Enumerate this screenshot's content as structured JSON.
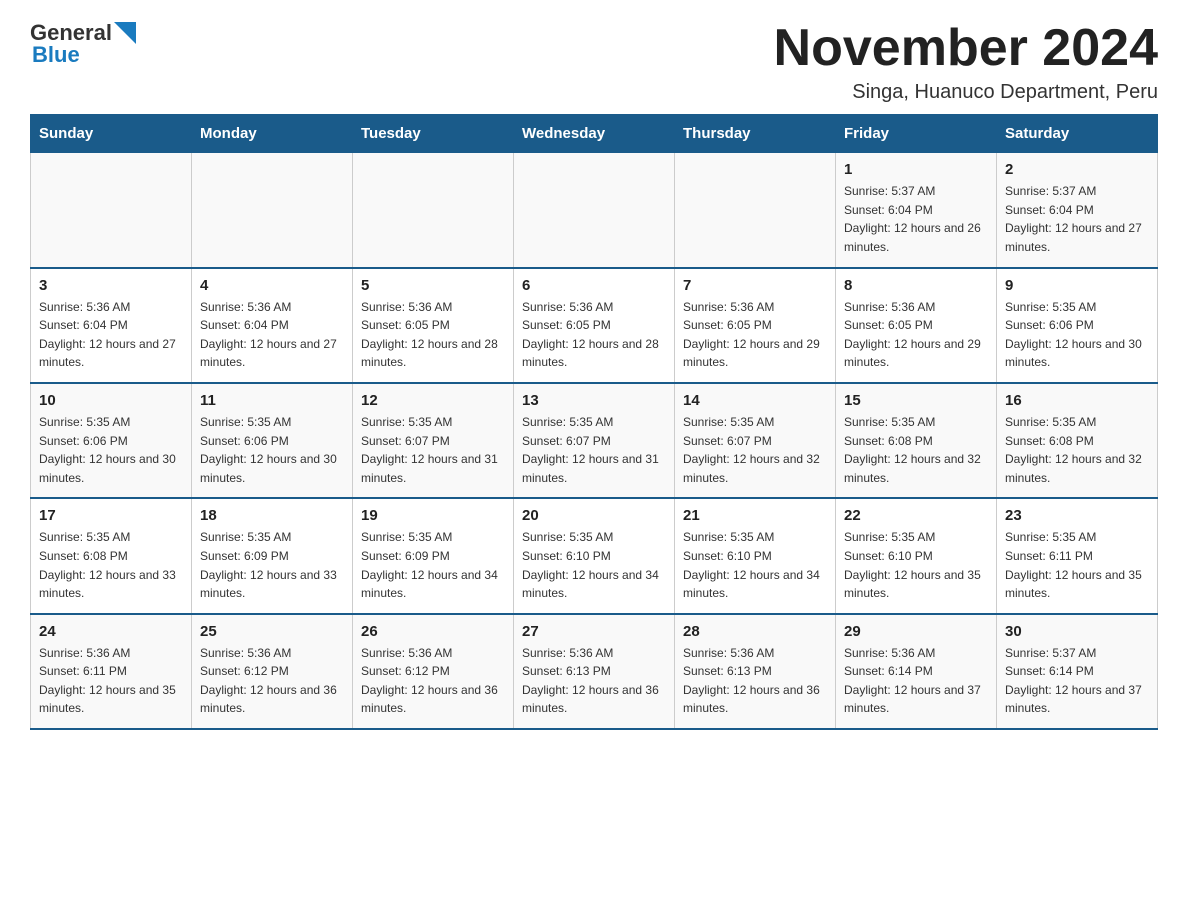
{
  "logo": {
    "text_general": "General",
    "text_blue": "Blue",
    "triangle_color": "#1a7bbf"
  },
  "title": "November 2024",
  "subtitle": "Singa, Huanuco Department, Peru",
  "days_of_week": [
    "Sunday",
    "Monday",
    "Tuesday",
    "Wednesday",
    "Thursday",
    "Friday",
    "Saturday"
  ],
  "weeks": [
    {
      "days": [
        {
          "num": "",
          "sunrise": "",
          "sunset": "",
          "daylight": ""
        },
        {
          "num": "",
          "sunrise": "",
          "sunset": "",
          "daylight": ""
        },
        {
          "num": "",
          "sunrise": "",
          "sunset": "",
          "daylight": ""
        },
        {
          "num": "",
          "sunrise": "",
          "sunset": "",
          "daylight": ""
        },
        {
          "num": "",
          "sunrise": "",
          "sunset": "",
          "daylight": ""
        },
        {
          "num": "1",
          "sunrise": "Sunrise: 5:37 AM",
          "sunset": "Sunset: 6:04 PM",
          "daylight": "Daylight: 12 hours and 26 minutes."
        },
        {
          "num": "2",
          "sunrise": "Sunrise: 5:37 AM",
          "sunset": "Sunset: 6:04 PM",
          "daylight": "Daylight: 12 hours and 27 minutes."
        }
      ]
    },
    {
      "days": [
        {
          "num": "3",
          "sunrise": "Sunrise: 5:36 AM",
          "sunset": "Sunset: 6:04 PM",
          "daylight": "Daylight: 12 hours and 27 minutes."
        },
        {
          "num": "4",
          "sunrise": "Sunrise: 5:36 AM",
          "sunset": "Sunset: 6:04 PM",
          "daylight": "Daylight: 12 hours and 27 minutes."
        },
        {
          "num": "5",
          "sunrise": "Sunrise: 5:36 AM",
          "sunset": "Sunset: 6:05 PM",
          "daylight": "Daylight: 12 hours and 28 minutes."
        },
        {
          "num": "6",
          "sunrise": "Sunrise: 5:36 AM",
          "sunset": "Sunset: 6:05 PM",
          "daylight": "Daylight: 12 hours and 28 minutes."
        },
        {
          "num": "7",
          "sunrise": "Sunrise: 5:36 AM",
          "sunset": "Sunset: 6:05 PM",
          "daylight": "Daylight: 12 hours and 29 minutes."
        },
        {
          "num": "8",
          "sunrise": "Sunrise: 5:36 AM",
          "sunset": "Sunset: 6:05 PM",
          "daylight": "Daylight: 12 hours and 29 minutes."
        },
        {
          "num": "9",
          "sunrise": "Sunrise: 5:35 AM",
          "sunset": "Sunset: 6:06 PM",
          "daylight": "Daylight: 12 hours and 30 minutes."
        }
      ]
    },
    {
      "days": [
        {
          "num": "10",
          "sunrise": "Sunrise: 5:35 AM",
          "sunset": "Sunset: 6:06 PM",
          "daylight": "Daylight: 12 hours and 30 minutes."
        },
        {
          "num": "11",
          "sunrise": "Sunrise: 5:35 AM",
          "sunset": "Sunset: 6:06 PM",
          "daylight": "Daylight: 12 hours and 30 minutes."
        },
        {
          "num": "12",
          "sunrise": "Sunrise: 5:35 AM",
          "sunset": "Sunset: 6:07 PM",
          "daylight": "Daylight: 12 hours and 31 minutes."
        },
        {
          "num": "13",
          "sunrise": "Sunrise: 5:35 AM",
          "sunset": "Sunset: 6:07 PM",
          "daylight": "Daylight: 12 hours and 31 minutes."
        },
        {
          "num": "14",
          "sunrise": "Sunrise: 5:35 AM",
          "sunset": "Sunset: 6:07 PM",
          "daylight": "Daylight: 12 hours and 32 minutes."
        },
        {
          "num": "15",
          "sunrise": "Sunrise: 5:35 AM",
          "sunset": "Sunset: 6:08 PM",
          "daylight": "Daylight: 12 hours and 32 minutes."
        },
        {
          "num": "16",
          "sunrise": "Sunrise: 5:35 AM",
          "sunset": "Sunset: 6:08 PM",
          "daylight": "Daylight: 12 hours and 32 minutes."
        }
      ]
    },
    {
      "days": [
        {
          "num": "17",
          "sunrise": "Sunrise: 5:35 AM",
          "sunset": "Sunset: 6:08 PM",
          "daylight": "Daylight: 12 hours and 33 minutes."
        },
        {
          "num": "18",
          "sunrise": "Sunrise: 5:35 AM",
          "sunset": "Sunset: 6:09 PM",
          "daylight": "Daylight: 12 hours and 33 minutes."
        },
        {
          "num": "19",
          "sunrise": "Sunrise: 5:35 AM",
          "sunset": "Sunset: 6:09 PM",
          "daylight": "Daylight: 12 hours and 34 minutes."
        },
        {
          "num": "20",
          "sunrise": "Sunrise: 5:35 AM",
          "sunset": "Sunset: 6:10 PM",
          "daylight": "Daylight: 12 hours and 34 minutes."
        },
        {
          "num": "21",
          "sunrise": "Sunrise: 5:35 AM",
          "sunset": "Sunset: 6:10 PM",
          "daylight": "Daylight: 12 hours and 34 minutes."
        },
        {
          "num": "22",
          "sunrise": "Sunrise: 5:35 AM",
          "sunset": "Sunset: 6:10 PM",
          "daylight": "Daylight: 12 hours and 35 minutes."
        },
        {
          "num": "23",
          "sunrise": "Sunrise: 5:35 AM",
          "sunset": "Sunset: 6:11 PM",
          "daylight": "Daylight: 12 hours and 35 minutes."
        }
      ]
    },
    {
      "days": [
        {
          "num": "24",
          "sunrise": "Sunrise: 5:36 AM",
          "sunset": "Sunset: 6:11 PM",
          "daylight": "Daylight: 12 hours and 35 minutes."
        },
        {
          "num": "25",
          "sunrise": "Sunrise: 5:36 AM",
          "sunset": "Sunset: 6:12 PM",
          "daylight": "Daylight: 12 hours and 36 minutes."
        },
        {
          "num": "26",
          "sunrise": "Sunrise: 5:36 AM",
          "sunset": "Sunset: 6:12 PM",
          "daylight": "Daylight: 12 hours and 36 minutes."
        },
        {
          "num": "27",
          "sunrise": "Sunrise: 5:36 AM",
          "sunset": "Sunset: 6:13 PM",
          "daylight": "Daylight: 12 hours and 36 minutes."
        },
        {
          "num": "28",
          "sunrise": "Sunrise: 5:36 AM",
          "sunset": "Sunset: 6:13 PM",
          "daylight": "Daylight: 12 hours and 36 minutes."
        },
        {
          "num": "29",
          "sunrise": "Sunrise: 5:36 AM",
          "sunset": "Sunset: 6:14 PM",
          "daylight": "Daylight: 12 hours and 37 minutes."
        },
        {
          "num": "30",
          "sunrise": "Sunrise: 5:37 AM",
          "sunset": "Sunset: 6:14 PM",
          "daylight": "Daylight: 12 hours and 37 minutes."
        }
      ]
    }
  ]
}
